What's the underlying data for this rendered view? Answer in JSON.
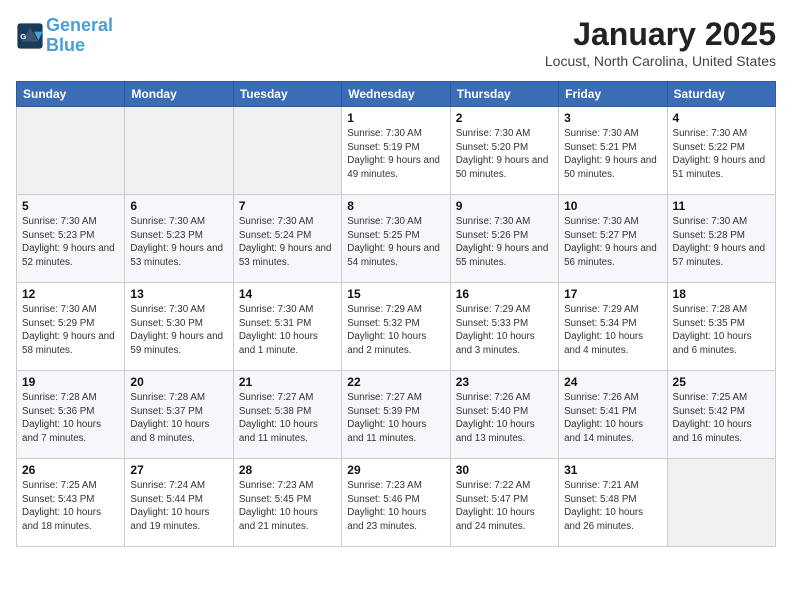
{
  "header": {
    "logo_line1": "General",
    "logo_line2": "Blue",
    "month": "January 2025",
    "location": "Locust, North Carolina, United States"
  },
  "weekdays": [
    "Sunday",
    "Monday",
    "Tuesday",
    "Wednesday",
    "Thursday",
    "Friday",
    "Saturday"
  ],
  "weeks": [
    [
      {
        "day": "",
        "sunrise": "",
        "sunset": "",
        "daylight": ""
      },
      {
        "day": "",
        "sunrise": "",
        "sunset": "",
        "daylight": ""
      },
      {
        "day": "",
        "sunrise": "",
        "sunset": "",
        "daylight": ""
      },
      {
        "day": "1",
        "sunrise": "Sunrise: 7:30 AM",
        "sunset": "Sunset: 5:19 PM",
        "daylight": "Daylight: 9 hours and 49 minutes."
      },
      {
        "day": "2",
        "sunrise": "Sunrise: 7:30 AM",
        "sunset": "Sunset: 5:20 PM",
        "daylight": "Daylight: 9 hours and 50 minutes."
      },
      {
        "day": "3",
        "sunrise": "Sunrise: 7:30 AM",
        "sunset": "Sunset: 5:21 PM",
        "daylight": "Daylight: 9 hours and 50 minutes."
      },
      {
        "day": "4",
        "sunrise": "Sunrise: 7:30 AM",
        "sunset": "Sunset: 5:22 PM",
        "daylight": "Daylight: 9 hours and 51 minutes."
      }
    ],
    [
      {
        "day": "5",
        "sunrise": "Sunrise: 7:30 AM",
        "sunset": "Sunset: 5:23 PM",
        "daylight": "Daylight: 9 hours and 52 minutes."
      },
      {
        "day": "6",
        "sunrise": "Sunrise: 7:30 AM",
        "sunset": "Sunset: 5:23 PM",
        "daylight": "Daylight: 9 hours and 53 minutes."
      },
      {
        "day": "7",
        "sunrise": "Sunrise: 7:30 AM",
        "sunset": "Sunset: 5:24 PM",
        "daylight": "Daylight: 9 hours and 53 minutes."
      },
      {
        "day": "8",
        "sunrise": "Sunrise: 7:30 AM",
        "sunset": "Sunset: 5:25 PM",
        "daylight": "Daylight: 9 hours and 54 minutes."
      },
      {
        "day": "9",
        "sunrise": "Sunrise: 7:30 AM",
        "sunset": "Sunset: 5:26 PM",
        "daylight": "Daylight: 9 hours and 55 minutes."
      },
      {
        "day": "10",
        "sunrise": "Sunrise: 7:30 AM",
        "sunset": "Sunset: 5:27 PM",
        "daylight": "Daylight: 9 hours and 56 minutes."
      },
      {
        "day": "11",
        "sunrise": "Sunrise: 7:30 AM",
        "sunset": "Sunset: 5:28 PM",
        "daylight": "Daylight: 9 hours and 57 minutes."
      }
    ],
    [
      {
        "day": "12",
        "sunrise": "Sunrise: 7:30 AM",
        "sunset": "Sunset: 5:29 PM",
        "daylight": "Daylight: 9 hours and 58 minutes."
      },
      {
        "day": "13",
        "sunrise": "Sunrise: 7:30 AM",
        "sunset": "Sunset: 5:30 PM",
        "daylight": "Daylight: 9 hours and 59 minutes."
      },
      {
        "day": "14",
        "sunrise": "Sunrise: 7:30 AM",
        "sunset": "Sunset: 5:31 PM",
        "daylight": "Daylight: 10 hours and 1 minute."
      },
      {
        "day": "15",
        "sunrise": "Sunrise: 7:29 AM",
        "sunset": "Sunset: 5:32 PM",
        "daylight": "Daylight: 10 hours and 2 minutes."
      },
      {
        "day": "16",
        "sunrise": "Sunrise: 7:29 AM",
        "sunset": "Sunset: 5:33 PM",
        "daylight": "Daylight: 10 hours and 3 minutes."
      },
      {
        "day": "17",
        "sunrise": "Sunrise: 7:29 AM",
        "sunset": "Sunset: 5:34 PM",
        "daylight": "Daylight: 10 hours and 4 minutes."
      },
      {
        "day": "18",
        "sunrise": "Sunrise: 7:28 AM",
        "sunset": "Sunset: 5:35 PM",
        "daylight": "Daylight: 10 hours and 6 minutes."
      }
    ],
    [
      {
        "day": "19",
        "sunrise": "Sunrise: 7:28 AM",
        "sunset": "Sunset: 5:36 PM",
        "daylight": "Daylight: 10 hours and 7 minutes."
      },
      {
        "day": "20",
        "sunrise": "Sunrise: 7:28 AM",
        "sunset": "Sunset: 5:37 PM",
        "daylight": "Daylight: 10 hours and 8 minutes."
      },
      {
        "day": "21",
        "sunrise": "Sunrise: 7:27 AM",
        "sunset": "Sunset: 5:38 PM",
        "daylight": "Daylight: 10 hours and 11 minutes."
      },
      {
        "day": "22",
        "sunrise": "Sunrise: 7:27 AM",
        "sunset": "Sunset: 5:39 PM",
        "daylight": "Daylight: 10 hours and 11 minutes."
      },
      {
        "day": "23",
        "sunrise": "Sunrise: 7:26 AM",
        "sunset": "Sunset: 5:40 PM",
        "daylight": "Daylight: 10 hours and 13 minutes."
      },
      {
        "day": "24",
        "sunrise": "Sunrise: 7:26 AM",
        "sunset": "Sunset: 5:41 PM",
        "daylight": "Daylight: 10 hours and 14 minutes."
      },
      {
        "day": "25",
        "sunrise": "Sunrise: 7:25 AM",
        "sunset": "Sunset: 5:42 PM",
        "daylight": "Daylight: 10 hours and 16 minutes."
      }
    ],
    [
      {
        "day": "26",
        "sunrise": "Sunrise: 7:25 AM",
        "sunset": "Sunset: 5:43 PM",
        "daylight": "Daylight: 10 hours and 18 minutes."
      },
      {
        "day": "27",
        "sunrise": "Sunrise: 7:24 AM",
        "sunset": "Sunset: 5:44 PM",
        "daylight": "Daylight: 10 hours and 19 minutes."
      },
      {
        "day": "28",
        "sunrise": "Sunrise: 7:23 AM",
        "sunset": "Sunset: 5:45 PM",
        "daylight": "Daylight: 10 hours and 21 minutes."
      },
      {
        "day": "29",
        "sunrise": "Sunrise: 7:23 AM",
        "sunset": "Sunset: 5:46 PM",
        "daylight": "Daylight: 10 hours and 23 minutes."
      },
      {
        "day": "30",
        "sunrise": "Sunrise: 7:22 AM",
        "sunset": "Sunset: 5:47 PM",
        "daylight": "Daylight: 10 hours and 24 minutes."
      },
      {
        "day": "31",
        "sunrise": "Sunrise: 7:21 AM",
        "sunset": "Sunset: 5:48 PM",
        "daylight": "Daylight: 10 hours and 26 minutes."
      },
      {
        "day": "",
        "sunrise": "",
        "sunset": "",
        "daylight": ""
      }
    ]
  ]
}
